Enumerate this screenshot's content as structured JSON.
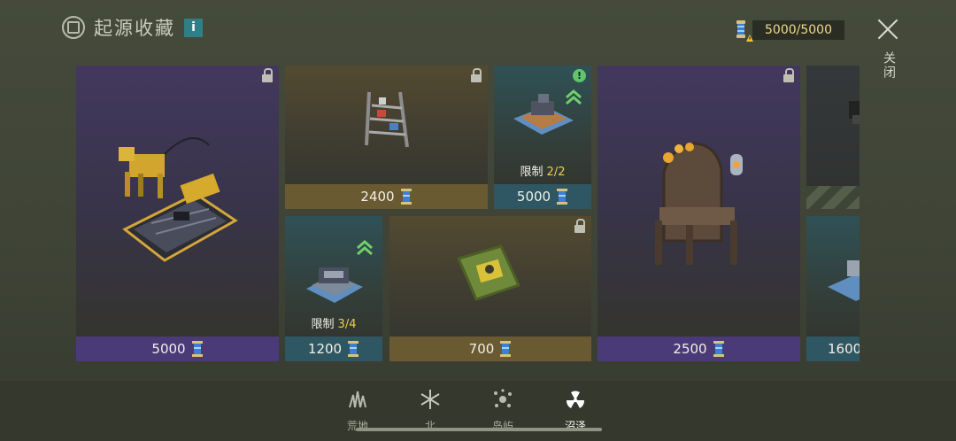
{
  "header": {
    "title": "起源收藏",
    "info_label": "i",
    "icon": "origin-emblem-icon"
  },
  "currency": {
    "value": "5000/5000",
    "icon": "blue-spool-icon",
    "warning_icon": "warning-triangle-icon"
  },
  "close": {
    "label": "关闭",
    "icon": "close-icon"
  },
  "cards": [
    {
      "id": "mech-dog",
      "price": "5000",
      "rarity": "purple",
      "icon": "mech-dog-workbench-icon",
      "locked": true
    },
    {
      "id": "shelf",
      "price": "2400",
      "rarity": "brown",
      "icon": "storage-shelf-icon",
      "locked": true
    },
    {
      "id": "workstation",
      "price": "5000",
      "rarity": "teal",
      "icon": "blueprint-workstation-icon",
      "limit_label": "限制",
      "limit_value": "2/2",
      "alert": "!",
      "upgradeable": true
    },
    {
      "id": "throne",
      "price": "2500",
      "rarity": "purple",
      "icon": "candle-throne-icon",
      "locked": true
    },
    {
      "id": "cut-top",
      "price": "",
      "rarity": "teal",
      "icon": "machine-icon"
    },
    {
      "id": "tank-blueprint",
      "price": "1200",
      "rarity": "teal",
      "icon": "tank-blueprint-icon",
      "limit_label": "限制",
      "limit_value": "3/4",
      "upgradeable": true
    },
    {
      "id": "swamp-chip",
      "price": "700",
      "rarity": "brown",
      "icon": "swamp-chip-icon",
      "locked": true
    },
    {
      "id": "cut-bottom",
      "price": "1600",
      "rarity": "teal",
      "icon": "blueprint-machine-icon"
    }
  ],
  "tabs": [
    {
      "label": "荒地",
      "icon": "grass-icon",
      "active": false
    },
    {
      "label": "北",
      "icon": "snowflake-icon",
      "active": false
    },
    {
      "label": "岛屿",
      "icon": "island-burst-icon",
      "active": false
    },
    {
      "label": "沼泽",
      "icon": "radiation-icon",
      "active": true
    }
  ],
  "colors": {
    "purple": "#4a3b78",
    "brown": "#6a5a32",
    "teal": "#2f5763",
    "gold": "#f0cf4b"
  }
}
